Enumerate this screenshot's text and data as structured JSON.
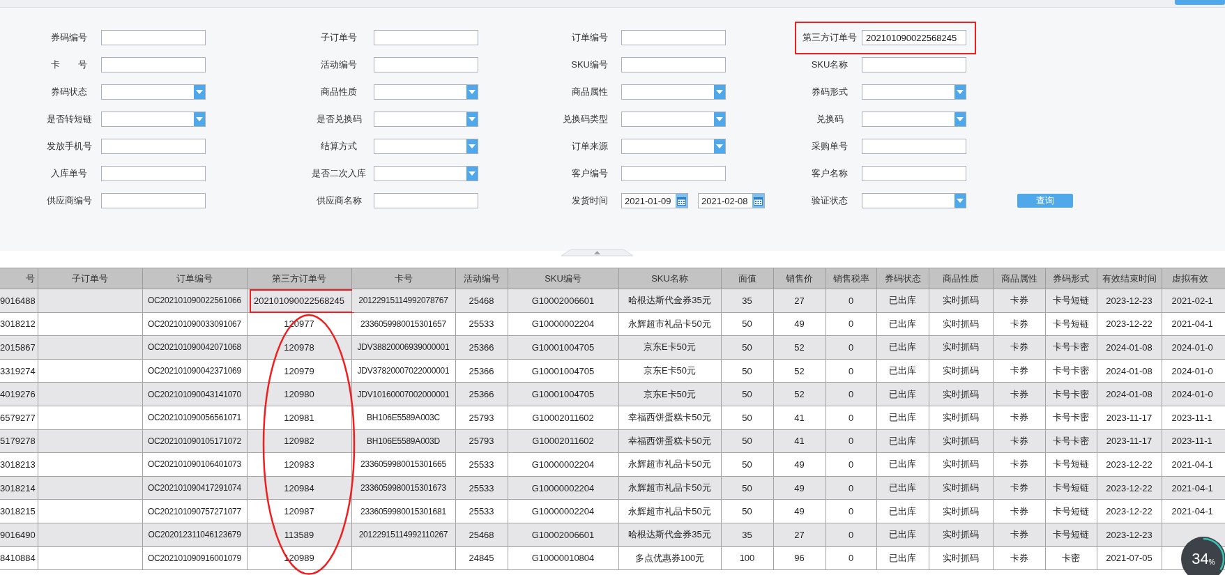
{
  "form": {
    "fields": [
      {
        "label": "券码编号",
        "kind": "text"
      },
      {
        "label": "子订单号",
        "kind": "text"
      },
      {
        "label": "订单编号",
        "kind": "text"
      },
      {
        "label": "第三方订单号",
        "kind": "text",
        "value": "202101090022568245",
        "marked": true
      },
      {
        "label": "卡　　号",
        "kind": "text"
      },
      {
        "label": "活动编号",
        "kind": "text"
      },
      {
        "label": "SKU编号",
        "kind": "text"
      },
      {
        "label": "SKU名称",
        "kind": "text"
      },
      {
        "label": "券码状态",
        "kind": "select"
      },
      {
        "label": "商品性质",
        "kind": "select"
      },
      {
        "label": "商品属性",
        "kind": "select"
      },
      {
        "label": "券码形式",
        "kind": "select"
      },
      {
        "label": "是否转短链",
        "kind": "select"
      },
      {
        "label": "是否兑换码",
        "kind": "select"
      },
      {
        "label": "兑换码类型",
        "kind": "select"
      },
      {
        "label": "兑换码",
        "kind": "select"
      },
      {
        "label": "发放手机号",
        "kind": "text"
      },
      {
        "label": "结算方式",
        "kind": "select"
      },
      {
        "label": "订单来源",
        "kind": "select"
      },
      {
        "label": "采购单号",
        "kind": "text"
      },
      {
        "label": "入库单号",
        "kind": "text"
      },
      {
        "label": "是否二次入库",
        "kind": "select"
      },
      {
        "label": "客户编号",
        "kind": "text"
      },
      {
        "label": "客户名称",
        "kind": "text"
      },
      {
        "label": "供应商编号",
        "kind": "text"
      },
      {
        "label": "供应商名称",
        "kind": "text"
      },
      {
        "label": "发货时间",
        "kind": "date_range",
        "values": [
          "2021-01-09",
          "2021-02-08"
        ]
      },
      {
        "label": "验证状态",
        "kind": "select"
      }
    ],
    "search_button": "查询"
  },
  "table": {
    "columns": [
      {
        "label": "号"
      },
      {
        "label": "子订单号"
      },
      {
        "label": "订单编号"
      },
      {
        "label": "第三方订单号",
        "marked": true
      },
      {
        "label": "卡号"
      },
      {
        "label": "活动编号"
      },
      {
        "label": "SKU编号"
      },
      {
        "label": "SKU名称"
      },
      {
        "label": "面值"
      },
      {
        "label": "销售价"
      },
      {
        "label": "销售税率"
      },
      {
        "label": "券码状态"
      },
      {
        "label": "商品性质"
      },
      {
        "label": "商品属性"
      },
      {
        "label": "券码形式"
      },
      {
        "label": "有效结束时间"
      },
      {
        "label": "虚拟有效"
      }
    ],
    "rows": [
      {
        "cells": [
          "9016488",
          null,
          "OC202101090022561066",
          "202101090022568245",
          "20122915114992078767",
          "25468",
          "G10002006601",
          "哈根达斯代金券35元",
          "35",
          "27",
          "0",
          "已出库",
          "实时抓码",
          "卡券",
          "卡号短链",
          "2023-12-23",
          "2021-02-1"
        ]
      },
      {
        "cells": [
          "3018212",
          null,
          "OC202101090033091067",
          "120977",
          "2336059980015301657",
          "25533",
          "G10000002204",
          "永辉超市礼品卡50元",
          "50",
          "49",
          "0",
          "已出库",
          "实时抓码",
          "卡券",
          "卡号短链",
          "2023-12-22",
          "2021-04-1"
        ]
      },
      {
        "cells": [
          "2015867",
          null,
          "OC202101090042071068",
          "120978",
          "JDV38820006939000001",
          "25366",
          "G10001004705",
          "京东E卡50元",
          "50",
          "52",
          "0",
          "已出库",
          "实时抓码",
          "卡券",
          "卡号卡密",
          "2024-01-08",
          "2024-01-0"
        ]
      },
      {
        "cells": [
          "3319274",
          null,
          "OC202101090042371069",
          "120979",
          "JDV37820007022000001",
          "25366",
          "G10001004705",
          "京东E卡50元",
          "50",
          "52",
          "0",
          "已出库",
          "实时抓码",
          "卡券",
          "卡号卡密",
          "2024-01-08",
          "2024-01-0"
        ]
      },
      {
        "cells": [
          "4019276",
          null,
          "OC202101090043141070",
          "120980",
          "JDV10160007002000001",
          "25366",
          "G10001004705",
          "京东E卡50元",
          "50",
          "52",
          "0",
          "已出库",
          "实时抓码",
          "卡券",
          "卡号卡密",
          "2024-01-08",
          "2024-01-0"
        ]
      },
      {
        "cells": [
          "6579277",
          null,
          "OC202101090056561071",
          "120981",
          "BH106E5589A003C",
          "25793",
          "G10002011602",
          "幸福西饼蛋糕卡50元",
          "50",
          "41",
          "0",
          "已出库",
          "实时抓码",
          "卡券",
          "卡号卡密",
          "2023-11-17",
          "2023-11-1"
        ]
      },
      {
        "cells": [
          "5179278",
          null,
          "OC202101090105171072",
          "120982",
          "BH106E5589A003D",
          "25793",
          "G10002011602",
          "幸福西饼蛋糕卡50元",
          "50",
          "41",
          "0",
          "已出库",
          "实时抓码",
          "卡券",
          "卡号卡密",
          "2023-11-17",
          "2023-11-1"
        ]
      },
      {
        "cells": [
          "3018213",
          null,
          "OC202101090106401073",
          "120983",
          "2336059980015301665",
          "25533",
          "G10000002204",
          "永辉超市礼品卡50元",
          "50",
          "49",
          "0",
          "已出库",
          "实时抓码",
          "卡券",
          "卡号短链",
          "2023-12-22",
          "2021-04-1"
        ]
      },
      {
        "cells": [
          "3018214",
          null,
          "OC202101090417291074",
          "120984",
          "2336059980015301673",
          "25533",
          "G10000002204",
          "永辉超市礼品卡50元",
          "50",
          "49",
          "0",
          "已出库",
          "实时抓码",
          "卡券",
          "卡号短链",
          "2023-12-22",
          "2021-04-1"
        ]
      },
      {
        "cells": [
          "3018215",
          null,
          "OC202101090757271077",
          "120987",
          "2336059980015301681",
          "25533",
          "G10000002204",
          "永辉超市礼品卡50元",
          "50",
          "49",
          "0",
          "已出库",
          "实时抓码",
          "卡券",
          "卡号短链",
          "2023-12-22",
          "2021-04-1"
        ]
      },
      {
        "cells": [
          "9016490",
          null,
          "OC202012311046123679",
          "113589",
          "20122915114992110267",
          "25468",
          "G10002006601",
          "哈根达斯代金券35元",
          "35",
          "27",
          "0",
          "已出库",
          "实时抓码",
          "卡券",
          "卡号短链",
          "2023-12-23",
          null
        ]
      },
      {
        "cells": [
          "8410884",
          null,
          "OC202101090916001079",
          "120989",
          null,
          "24845",
          "G10000010804",
          "多点优惠券100元",
          "100",
          "96",
          "0",
          "已出库",
          "实时抓码",
          "卡券",
          "卡密",
          "2021-07-05",
          null
        ]
      }
    ]
  },
  "progress_widget": {
    "value": "34",
    "unit": "%",
    "level": 0.34
  }
}
